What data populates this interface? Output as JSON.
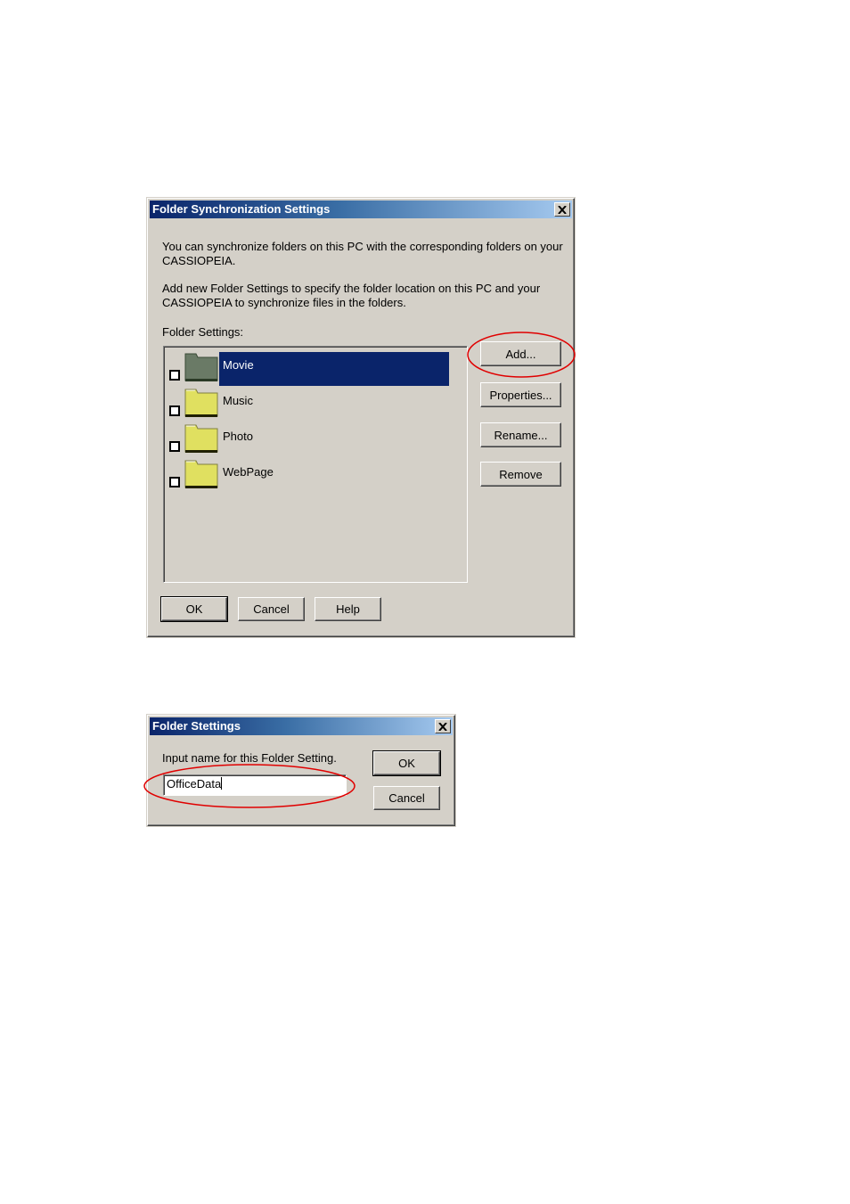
{
  "sync_dialog": {
    "title": "Folder Synchronization Settings",
    "intro_line1": "You can synchronize folders on this PC with the corresponding folders on your",
    "intro_line2": "CASSIOPEIA.",
    "add_line1": "Add new Folder Settings to specify the folder location on this PC and your",
    "add_line2": "CASSIOPEIA to synchronize files in the folders.",
    "list_label": "Folder Settings:",
    "folders": [
      {
        "label": "Movie",
        "selected": true,
        "checked": false
      },
      {
        "label": "Music",
        "selected": false,
        "checked": false
      },
      {
        "label": "Photo",
        "selected": false,
        "checked": false
      },
      {
        "label": "WebPage",
        "selected": false,
        "checked": false
      }
    ],
    "buttons": {
      "add": "Add...",
      "properties": "Properties...",
      "rename": "Rename...",
      "remove": "Remove",
      "ok": "OK",
      "cancel": "Cancel",
      "help": "Help"
    }
  },
  "folder_dialog": {
    "title": "Folder Stettings",
    "prompt": "Input name for this Folder Setting.",
    "name_value": "OfficeData",
    "buttons": {
      "ok": "OK",
      "cancel": "Cancel"
    }
  },
  "colors": {
    "dialog_face": "#d4d0c8",
    "title_active": "#0a246a",
    "annotation": "#e00000",
    "folder_yellow": "#e0e060",
    "folder_selected": "#6a7a66"
  }
}
